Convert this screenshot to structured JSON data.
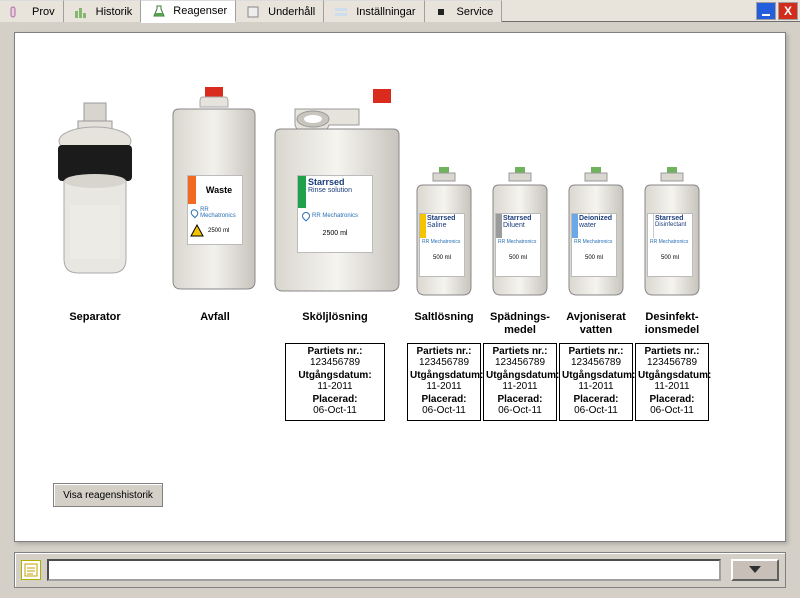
{
  "tabs": {
    "prov": "Prov",
    "hist": "Historik",
    "reag": "Reagenser",
    "under": "Underhåll",
    "inst": "Inställningar",
    "serv": "Service"
  },
  "winbtns": {
    "minimize": "_",
    "close": "X"
  },
  "reagents": {
    "separator": {
      "title": "Separator"
    },
    "waste": {
      "title": "Avfall",
      "label_name": "Waste",
      "label_brand": "RR Mechatronics",
      "label_vol": "2500 ml"
    },
    "rinse": {
      "title": "Sköljlösning",
      "label_name": "Starrsed",
      "label_sub": "Rinse solution",
      "label_brand": "RR Mechatronics",
      "label_vol": "2500 ml"
    },
    "saline": {
      "title": "Saltlösning",
      "label_name": "Starrsed",
      "label_sub": "Saline",
      "label_brand": "RR Mechatronics",
      "label_vol": "500 ml"
    },
    "diluent": {
      "title": "Spädnings-\nmedel",
      "label_name": "Starrsed",
      "label_sub": "Diluent",
      "label_brand": "RR Mechatronics",
      "label_vol": "500 ml"
    },
    "deion": {
      "title": "Avjoniserat\nvatten",
      "label_name": "Deionized",
      "label_sub": "water",
      "label_brand": "RR Mechatronics",
      "label_vol": "500 ml"
    },
    "disinf": {
      "title": "Desinfekt-\nionsmedel",
      "label_name": "Starrsed",
      "label_sub": "Disinfectant",
      "label_brand": "RR Mechatronics",
      "label_vol": "500 ml"
    }
  },
  "info_labels": {
    "batch": "Partiets nr.:",
    "expiry": "Utgångsdatum:",
    "placed": "Placerad:"
  },
  "info": {
    "rinse": {
      "batch": "123456789",
      "expiry": "11-2011",
      "placed": "06-Oct-11"
    },
    "saline": {
      "batch": "123456789",
      "expiry": "11-2011",
      "placed": "06-Oct-11"
    },
    "diluent": {
      "batch": "123456789",
      "expiry": "11-2011",
      "placed": "06-Oct-11"
    },
    "deion": {
      "batch": "123456789",
      "expiry": "11-2011",
      "placed": "06-Oct-11"
    },
    "disinf": {
      "batch": "123456789",
      "expiry": "11-2011",
      "placed": "06-Oct-11"
    }
  },
  "buttons": {
    "history": "Visa reagenshistorik"
  },
  "colors": {
    "waste_stripe": "#f26a21",
    "rinse_stripe": "#1fa24a",
    "saline_stripe": "#f5c400",
    "diluent_stripe": "#9b9b9b",
    "deion_stripe": "#6aa8e8",
    "disinf_stripe": "#ffffff"
  }
}
